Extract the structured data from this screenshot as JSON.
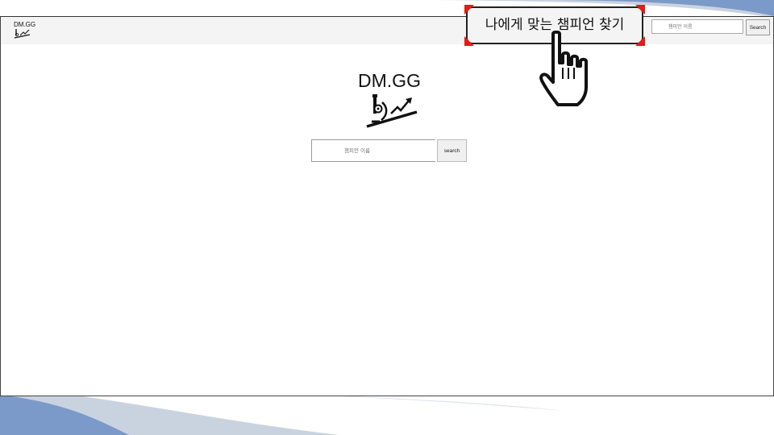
{
  "brand": {
    "name": "DM.GG"
  },
  "header": {
    "search_placeholder": "챔피언 이름",
    "search_button": "Search"
  },
  "main": {
    "logo_text": "DM.GG",
    "search_placeholder": "챔피언 이름",
    "search_button": "search"
  },
  "callout": {
    "label": "나에게 맞는 챔피언 찾기"
  },
  "icons": {
    "logo": "microscope-chart-icon",
    "cursor": "hand-pointer-icon"
  },
  "colors": {
    "highlight_corner": "#e41b17",
    "slide_accent": "#7b9ac9",
    "slide_accent_light": "#c9d3e0"
  }
}
